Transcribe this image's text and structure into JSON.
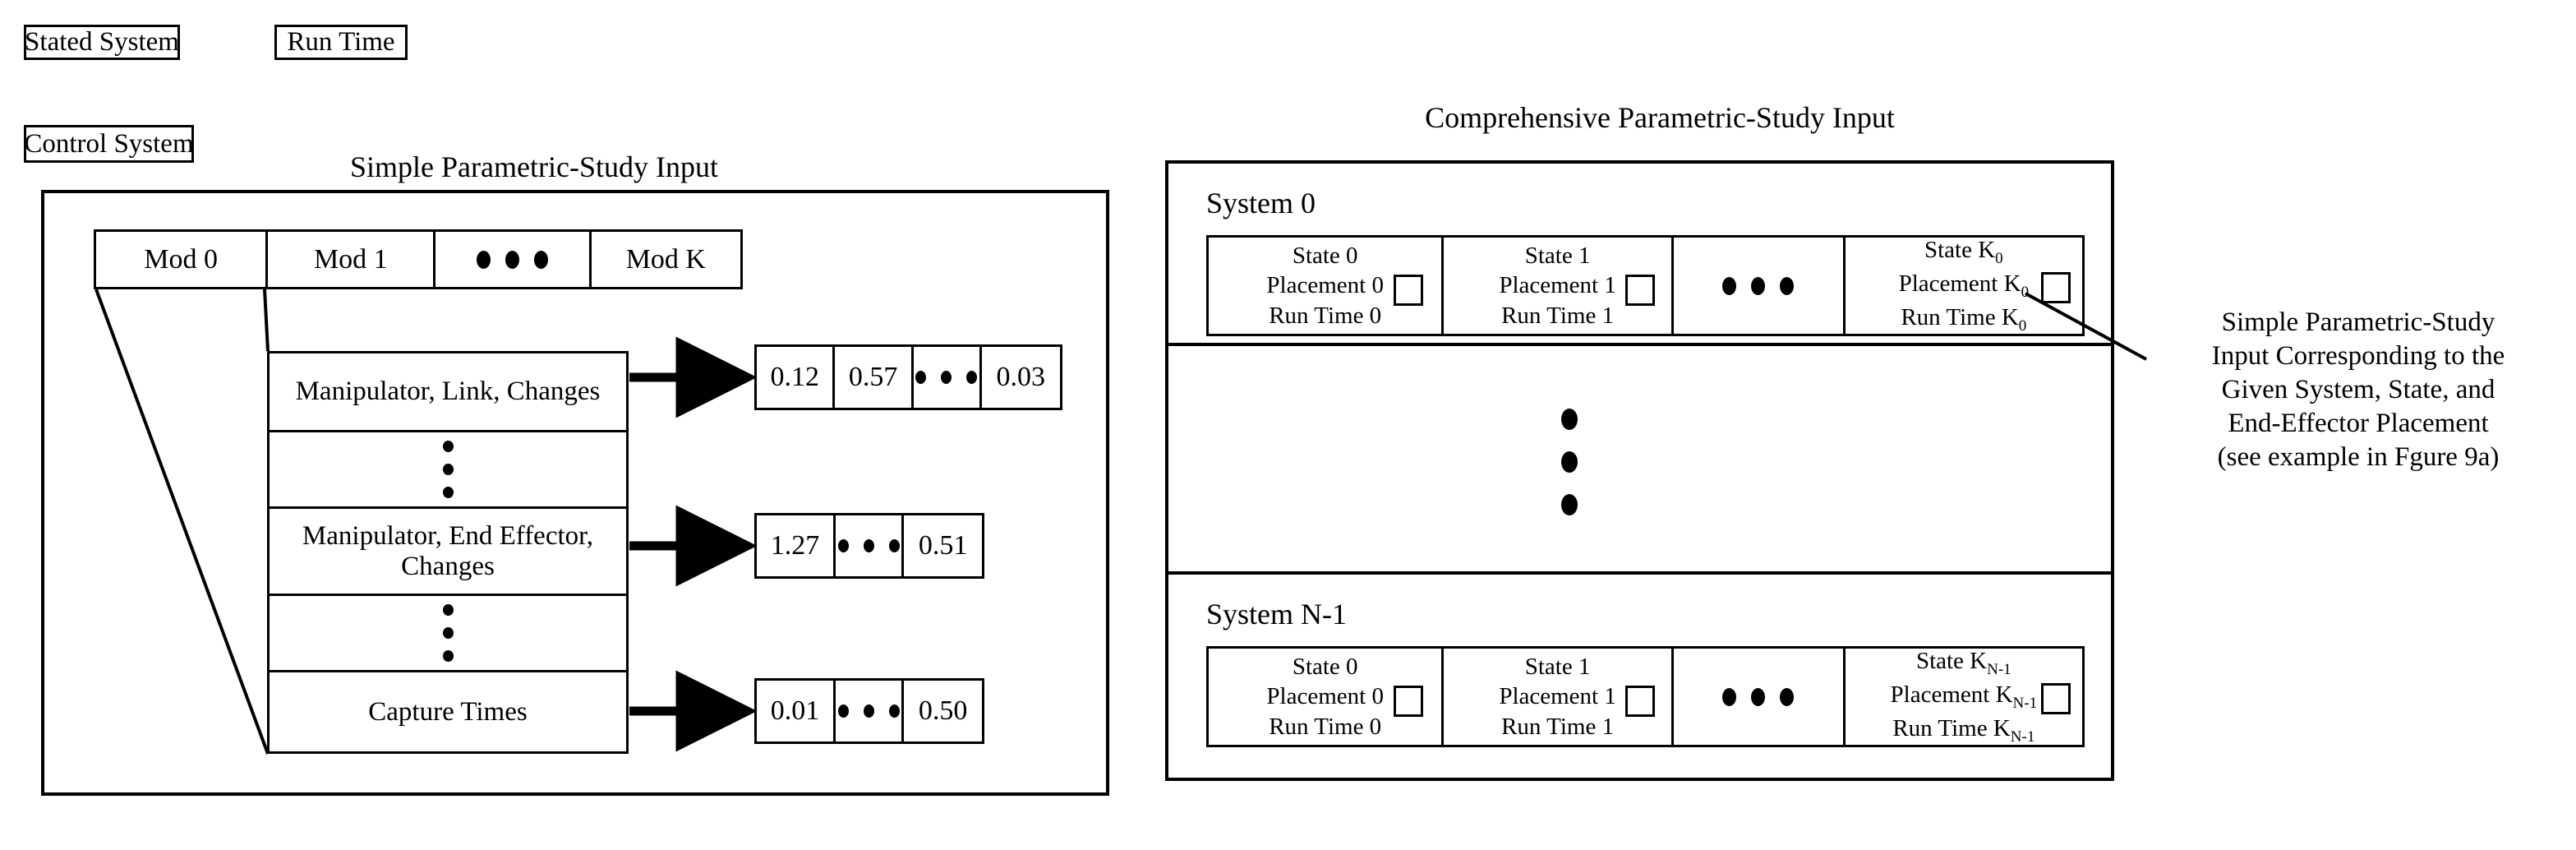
{
  "legend": {
    "chips": [
      {
        "label": "Stated System"
      },
      {
        "label": "Run Time"
      },
      {
        "label": "Control System"
      }
    ]
  },
  "left_panel": {
    "title": "Simple Parametric-Study Input",
    "mod_header": {
      "cells": [
        "Mod 0",
        "Mod 1",
        "dots",
        "Mod K"
      ]
    },
    "rows": [
      {
        "type": "text",
        "label": "Manipulator, Link, Changes"
      },
      {
        "type": "vdots",
        "label": ""
      },
      {
        "type": "text",
        "label": "Manipulator, End Effector, Changes"
      },
      {
        "type": "vdots",
        "label": ""
      },
      {
        "type": "text",
        "label": "Capture Times"
      }
    ],
    "value_strips": [
      {
        "cells": [
          "0.12",
          "0.57",
          "dots",
          "0.03"
        ]
      },
      {
        "cells": [
          "1.27",
          "dots",
          "0.51"
        ]
      },
      {
        "cells": [
          "0.01",
          "dots",
          "0.50"
        ]
      }
    ]
  },
  "right_panel": {
    "title": "Comprehensive Parametric-Study Input",
    "systems": [
      {
        "name": "System 0",
        "states": [
          {
            "state": "State 0",
            "placement": "Placement 0",
            "run_time": "Run Time 0",
            "marker": "checkbox-square"
          },
          {
            "state": "State 1",
            "placement": "Placement 1",
            "run_time": "Run Time 1",
            "marker": "checkbox-square"
          },
          {
            "state": "dots",
            "placement": "",
            "run_time": "",
            "marker": ""
          },
          {
            "state": "State K",
            "state_sub": "0",
            "placement": "Placement K",
            "placement_sub": "0",
            "run_time": "Run Time K",
            "run_time_sub": "0",
            "marker": "checkbox-square"
          }
        ]
      },
      {
        "name": "System N-1",
        "states": [
          {
            "state": "State 0",
            "placement": "Placement 0",
            "run_time": "Run Time 0",
            "marker": "checkbox-square"
          },
          {
            "state": "State 1",
            "placement": "Placement 1",
            "run_time": "Run Time 1",
            "marker": "checkbox-square"
          },
          {
            "state": "dots",
            "placement": "",
            "run_time": "",
            "marker": ""
          },
          {
            "state": "State K",
            "state_sub": "N-1",
            "placement": "Placement K",
            "placement_sub": "N-1",
            "run_time": "Run Time K",
            "run_time_sub": "N-1",
            "marker": "checkbox-square"
          }
        ]
      }
    ]
  },
  "annotation": {
    "lines": [
      "Simple Parametric-Study",
      "Input Corresponding to the",
      "Given System, State, and",
      "End-Effector Placement",
      "(see example in Fgure 9a)"
    ]
  },
  "colors": {
    "ink": "#000000",
    "paper": "#ffffff"
  }
}
